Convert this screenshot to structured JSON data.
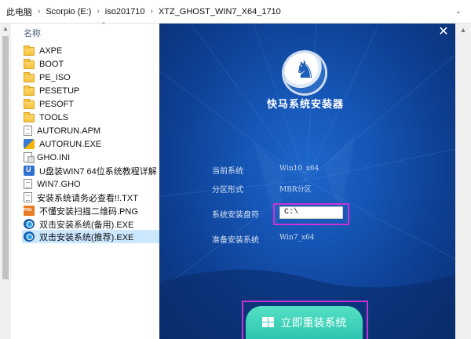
{
  "address_bar": {
    "crumbs": [
      "此电脑",
      "Scorpio (E:)",
      "iso201710",
      "XTZ_GHOST_WIN7_X64_1710"
    ],
    "separator": "›",
    "dropdown_icon": "chevron-down-icon"
  },
  "file_list": {
    "column_header": "名称",
    "sort_icon": "sort-up-icon",
    "items": [
      {
        "name": "AXPE",
        "icon": "folder-icon"
      },
      {
        "name": "BOOT",
        "icon": "folder-icon"
      },
      {
        "name": "PE_ISO",
        "icon": "folder-icon"
      },
      {
        "name": "PESETUP",
        "icon": "folder-icon"
      },
      {
        "name": "PESOFT",
        "icon": "folder-icon"
      },
      {
        "name": "TOOLS",
        "icon": "folder-icon"
      },
      {
        "name": "AUTORUN.APM",
        "icon": "document-icon"
      },
      {
        "name": "AUTORUN.EXE",
        "icon": "exe-icon"
      },
      {
        "name": "GHO.INI",
        "icon": "settings-file-icon"
      },
      {
        "name": "U盘装WIN7 64位系统教程详解",
        "icon": "udisk-icon"
      },
      {
        "name": "WIN7.GHO",
        "icon": "document-icon"
      },
      {
        "name": "安装系统请务必查看!!.TXT",
        "icon": "text-file-icon"
      },
      {
        "name": "不懂安装扫描二维码.PNG",
        "icon": "png-icon"
      },
      {
        "name": "双击安装系统(备用).EXE",
        "icon": "app-icon"
      },
      {
        "name": "双击安装系统(推荐).EXE",
        "icon": "app-icon",
        "selected": true
      }
    ]
  },
  "installer": {
    "title": "快马系统安装器",
    "close_icon": "close-icon",
    "fields": [
      {
        "label": "当前系统",
        "value": "Win10_x64"
      },
      {
        "label": "分区形式",
        "value": "MBR分区"
      },
      {
        "label": "系统安装盘符",
        "value": "C:\\"
      },
      {
        "label": "准备安装系统",
        "value": "Win7_x64"
      }
    ],
    "reinstall_button": "立即重装系统",
    "highlight_color": "#c733d4",
    "button_color": "#3fd0b8"
  }
}
